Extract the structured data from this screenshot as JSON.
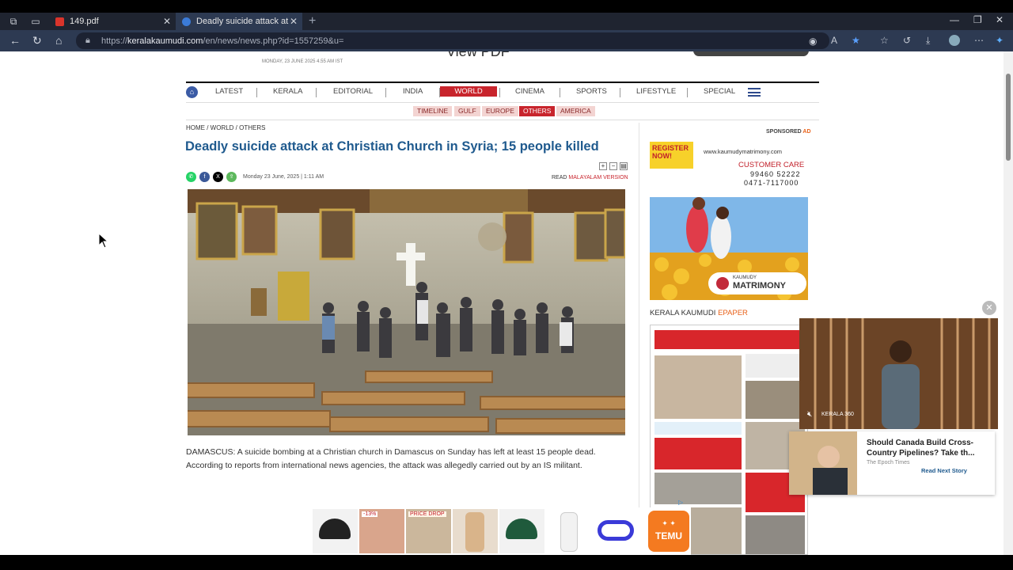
{
  "browser": {
    "tabs": [
      {
        "title": "149.pdf",
        "active": false
      },
      {
        "title": "Deadly suicide attack at Christian",
        "active": true
      }
    ],
    "url_prefix": "https://",
    "url_domain": "keralakaumudi.com",
    "url_path": "/en/news/news.php?id=1557259&u="
  },
  "site": {
    "top_date": "MONDAY, 23 JUNE 2025 4.55 AM IST",
    "view_pdf": "View PDF",
    "nav": [
      "LATEST",
      "KERALA",
      "EDITORIAL",
      "INDIA",
      "WORLD",
      "CINEMA",
      "SPORTS",
      "LIFESTYLE",
      "SPECIAL"
    ],
    "nav_active": "WORLD",
    "subnav": [
      "TIMELINE",
      "GULF",
      "EUROPE",
      "OTHERS",
      "AMERICA"
    ],
    "subnav_active": "OTHERS"
  },
  "article": {
    "breadcrumb": "HOME / WORLD / OTHERS",
    "headline": "Deadly suicide attack at Christian Church in Syria; 15 people killed",
    "date": "Monday 23 June, 2025 | 1:11 AM",
    "read_prefix": "READ",
    "read_link": "MALAYALAM VERSION",
    "body": "DAMASCUS: A suicide bombing at a Christian church in Damascus on Sunday has left at least 15 people dead. According to reports from international news agencies, the attack was allegedly carried out by an IS militant."
  },
  "sidebar": {
    "sponsored": "SPONSORED",
    "sponsored_ad": "AD",
    "ad_register": "REGISTER NOW!",
    "ad_site": "www.kaumudymatrimony.com",
    "ad_care": "CUSTOMER CARE",
    "ad_phone1": "99460 52222",
    "ad_phone2": "0471-7117000",
    "ad_brand_small": "KAUMUDY",
    "ad_brand": "MATRIMONY",
    "epaper_label": "KERALA KAUMUDI",
    "epaper_link": "EPAPER"
  },
  "video": {
    "brand": "KERALA 360"
  },
  "next_story": {
    "title": "Should Canada Build Cross-Country Pipelines? Take th...",
    "source": "The Epoch Times",
    "cta": "Read Next Story"
  },
  "ads_strip": {
    "badge1": "-13%",
    "badge2": "PRICE DROP",
    "temu": "TEMU"
  }
}
